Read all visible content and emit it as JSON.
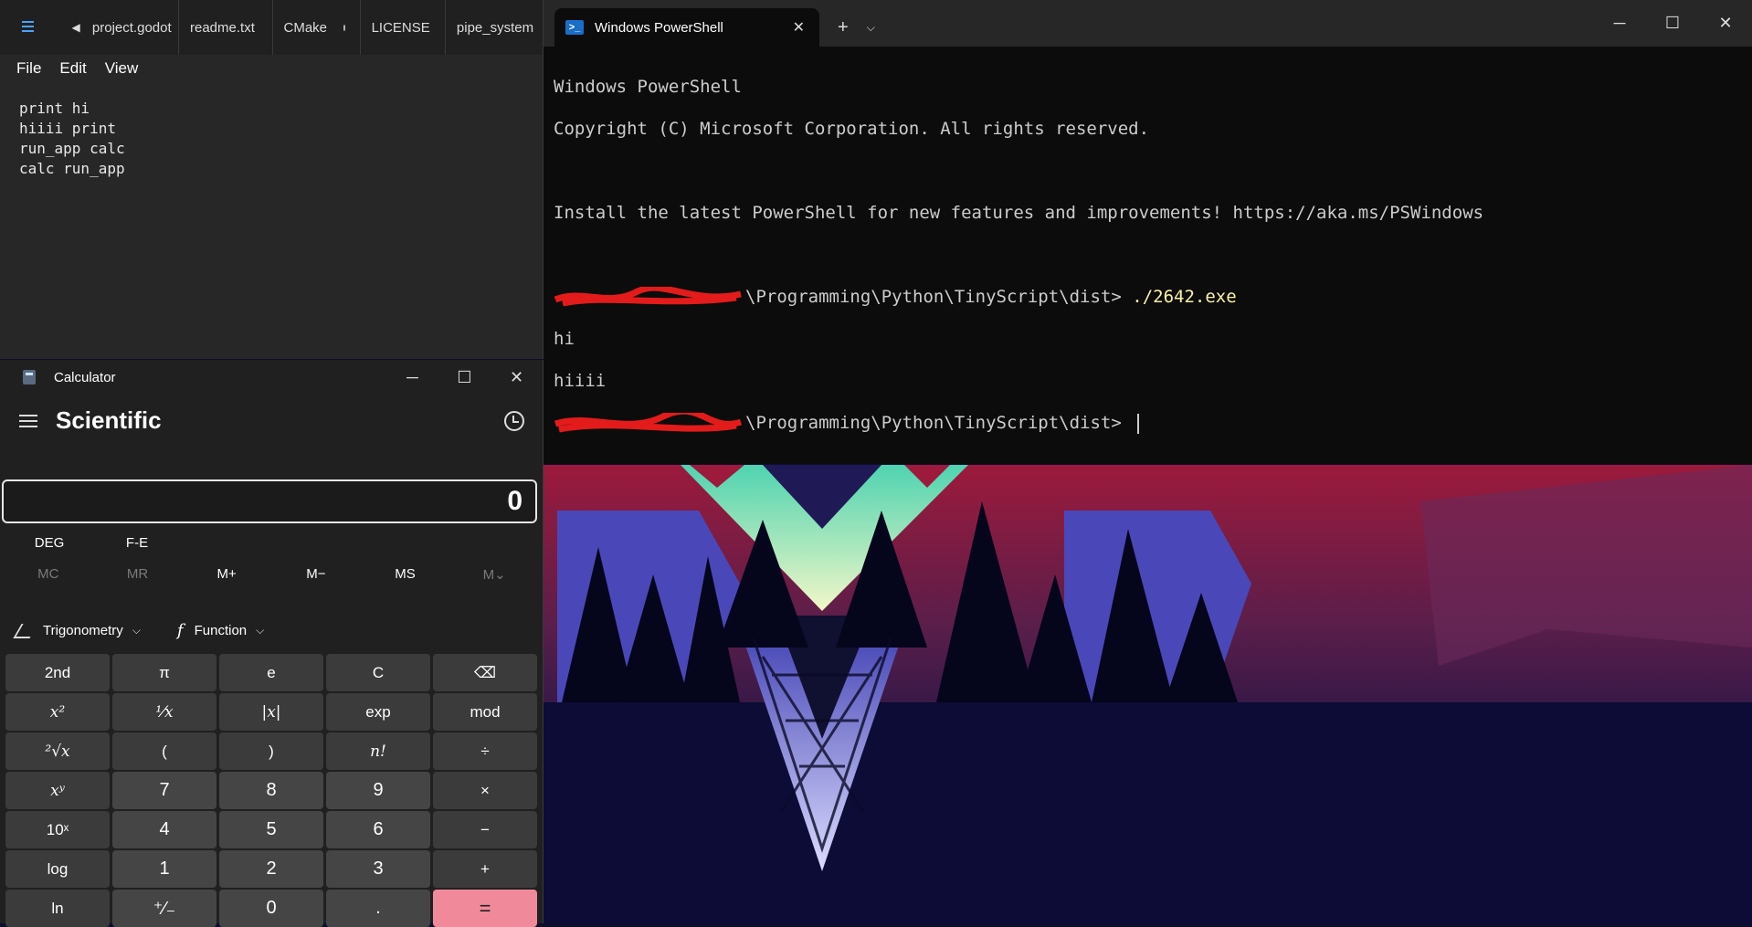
{
  "notepad": {
    "tabs": [
      "project.godot",
      "readme.txt",
      "CMake",
      "LICENSE",
      "pipe_system"
    ],
    "menu": [
      "File",
      "Edit",
      "View"
    ],
    "lines": [
      "print hi",
      "hiiii print",
      "run_app calc",
      "calc run_app"
    ]
  },
  "calculator": {
    "title": "Calculator",
    "mode": "Scientific",
    "display": "0",
    "angle": [
      "DEG",
      "F-E"
    ],
    "memory": [
      "MC",
      "MR",
      "M+",
      "M−",
      "MS",
      "M⌄"
    ],
    "trig_label": "Trigonometry",
    "func_label": "Function",
    "keys": {
      "second": "2nd",
      "pi": "π",
      "e": "e",
      "clear": "C",
      "backspace": "⌫",
      "sq": "x²",
      "recip": "¹⁄x",
      "abs": "|x|",
      "exp": "exp",
      "mod": "mod",
      "sqrt": "²√x",
      "lparen": "(",
      "rparen": ")",
      "fact": "n!",
      "div": "÷",
      "pow": "xʸ",
      "n7": "7",
      "n8": "8",
      "n9": "9",
      "mul": "×",
      "tenpow": "10ˣ",
      "n4": "4",
      "n5": "5",
      "n6": "6",
      "sub": "−",
      "log": "log",
      "n1": "1",
      "n2": "2",
      "n3": "3",
      "add": "+",
      "ln": "ln",
      "neg": "⁺⁄₋",
      "n0": "0",
      "dot": ".",
      "eq": "="
    }
  },
  "powershell": {
    "tab_title": "Windows PowerShell",
    "lines": {
      "l1": "Windows PowerShell",
      "l2": "Copyright (C) Microsoft Corporation. All rights reserved.",
      "l3": "Install the latest PowerShell for new features and improvements! https://aka.ms/PSWindows",
      "prompt1_path": "\\Programming\\Python\\TinyScript\\dist> ",
      "prompt1_cmd": "./2642.exe",
      "out1": "hi",
      "out2": "hiiii",
      "prompt2_path": "\\Programming\\Python\\TinyScript\\dist> "
    }
  },
  "colors": {
    "eq_button": "#f08a9b",
    "terminal_bg": "#0c0c0c",
    "command": "#f9f1a5"
  }
}
